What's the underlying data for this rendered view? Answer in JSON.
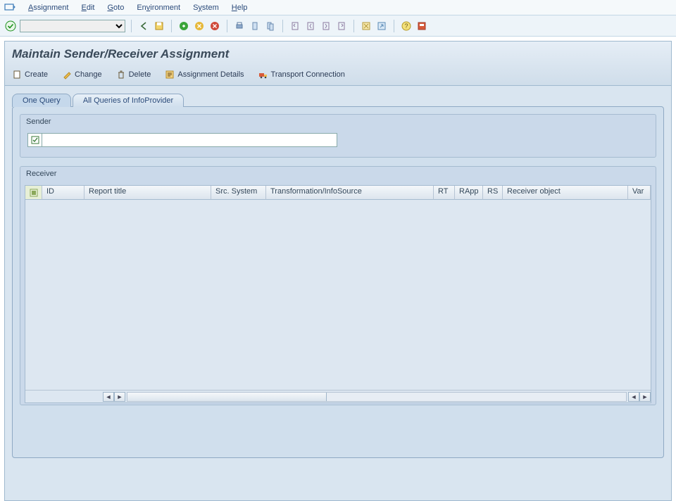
{
  "menu": {
    "items": [
      "Assignment",
      "Edit",
      "Goto",
      "Environment",
      "System",
      "Help"
    ]
  },
  "toolbar_names": {
    "ok": "enter-ok",
    "back": "back",
    "save": "save",
    "exit_green": "exit",
    "exit_yellow": "cancel",
    "exit_red": "close-session",
    "print": "print",
    "find": "find",
    "find_next": "find-next",
    "first": "first-page",
    "prev": "previous-page",
    "next": "next-page",
    "last": "last-page",
    "new_session": "new-session",
    "shortcut": "create-shortcut",
    "help": "help",
    "layout": "local-layout"
  },
  "title": "Maintain Sender/Receiver Assignment",
  "actions": {
    "create": "Create",
    "change": "Change",
    "delete": "Delete",
    "details": "Assignment Details",
    "transport": "Transport Connection"
  },
  "tabs": {
    "one": "One Query",
    "all": "All Queries of InfoProvider"
  },
  "sender": {
    "label": "Sender",
    "value": ""
  },
  "receiver": {
    "label": "Receiver",
    "columns": {
      "id": "ID",
      "report_title": "Report title",
      "src_system": "Src. System",
      "transformation": "Transformation/InfoSource",
      "rt": "RT",
      "rapp": "RApp",
      "rs": "RS",
      "receiver_object": "Receiver object",
      "var": "Var"
    }
  }
}
